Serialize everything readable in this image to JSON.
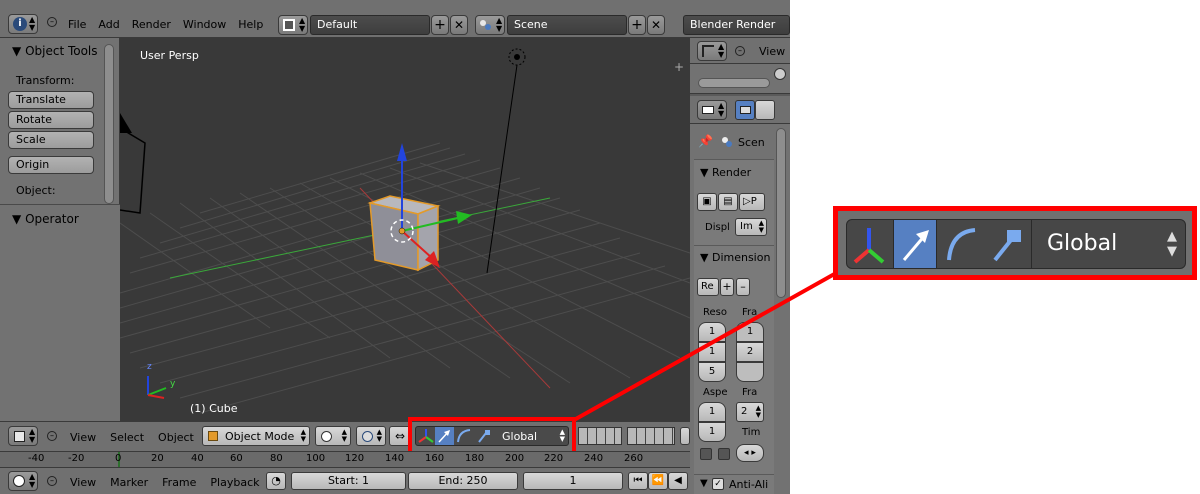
{
  "top_header": {
    "menus": [
      "File",
      "Add",
      "Render",
      "Window",
      "Help"
    ],
    "layout": "Default",
    "scene": "Scene",
    "engine": "Blender Render"
  },
  "tool_shelf": {
    "title": "Object Tools",
    "transform_label": "Transform:",
    "buttons": [
      "Translate",
      "Rotate",
      "Scale"
    ],
    "origin": "Origin",
    "object_label": "Object:",
    "operator": "Operator"
  },
  "viewport": {
    "view_name": "User Persp",
    "active_object": "(1) Cube",
    "axes": {
      "x": "x",
      "y": "y",
      "z": "z"
    }
  },
  "view3d_header": {
    "menus": [
      "View",
      "Select",
      "Object"
    ],
    "mode": "Object Mode",
    "orientation": "Global"
  },
  "timeline": {
    "ticks": [
      "-40",
      "-20",
      "0",
      "20",
      "40",
      "60",
      "80",
      "100",
      "120",
      "140",
      "160",
      "180",
      "200",
      "220",
      "240",
      "260"
    ],
    "menus": [
      "View",
      "Marker",
      "Frame",
      "Playback"
    ],
    "start": "Start: 1",
    "end": "End: 250",
    "current": "1"
  },
  "outliner": {
    "view": "View"
  },
  "properties": {
    "scene_tab": "Scen",
    "render_section": "Render",
    "display_label": "Displ",
    "display_value": "Im",
    "dimensions_section": "Dimension",
    "preset_value": "Re",
    "resolution_label": "Reso",
    "frame_label": "Fra",
    "res_values": [
      "1",
      "1",
      "5"
    ],
    "frame_values": [
      "1",
      "2"
    ],
    "aspect_label": "Aspe",
    "aspect_values": [
      "1",
      "1"
    ],
    "frame_rate_label": "Fra",
    "frame_rate_value": "2",
    "time_label": "Tim",
    "anti_alias": "Anti-Ali"
  },
  "zoom_callout": {
    "orientation": "Global",
    "highlight_color": "#ff0000"
  }
}
